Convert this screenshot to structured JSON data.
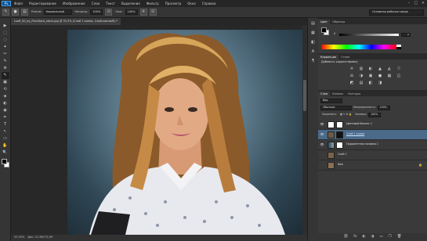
{
  "app": {
    "logo": "Ps"
  },
  "menu": [
    "Файл",
    "Редактирование",
    "Изображение",
    "Слои",
    "Текст",
    "Выделение",
    "Фильтр",
    "Просмотр",
    "Окно",
    "Справка"
  ],
  "window_buttons": [
    "–",
    "□",
    "×"
  ],
  "options": {
    "feather_label": "Режим:",
    "mode_value": "Нормальный",
    "opacity_label": "Непрозр.:",
    "opacity_value": "100%",
    "flow_label": "Наж.:",
    "flow_value": "100%",
    "workspace": "Основная рабочая среда"
  },
  "document_tab": "Lsoff_00_by_FlexStock_stock.jpg @ 33,3% (Слой 1 копия, Слой-маска/8) *",
  "status": {
    "zoom": "33,33%",
    "doc": "Док: 22,9М/73,2М"
  },
  "color_panel": {
    "tabs": [
      "Цвет",
      "Образцы"
    ],
    "sliders": [
      {
        "letter": "K",
        "value": "0",
        "level": 0.0
      }
    ],
    "fg_color": "#000000",
    "bg_color": "#ffffff"
  },
  "adjustments": {
    "tabs": [
      "Коррекция",
      "Стили"
    ],
    "title": "Добавить корректировку",
    "icons": [
      "☀",
      "▥",
      "◐",
      "▲",
      "◭",
      "▽",
      "⚖",
      "◑",
      "▣",
      "●",
      "▦",
      "◫",
      "◩",
      "▤",
      "◧",
      "◨"
    ]
  },
  "layers_panel": {
    "tabs": [
      "Слои",
      "Каналы",
      "Контуры"
    ],
    "kind_label": "Вид",
    "blend_mode": "Обычные",
    "opacity_label": "Непрозрачность:",
    "opacity_value": "100%",
    "lock_label": "Закрепить:",
    "fill_label": "Заливка:",
    "fill_value": "100%",
    "layers": [
      {
        "name": "Цветовой баланс 1",
        "thumb": "#ffffff",
        "visible": true,
        "selected": false,
        "link": false,
        "lock": ""
      },
      {
        "name": "Слой 1 копия",
        "thumb": "#6e5a44",
        "visible": true,
        "selected": true,
        "link": true,
        "lock": ""
      },
      {
        "name": "Градиентная заливка 1",
        "thumb": "#4f6b7d",
        "visible": true,
        "selected": false,
        "link": false,
        "lock": ""
      },
      {
        "name": "Слой 1",
        "thumb": "#7a6348",
        "visible": false,
        "selected": false,
        "link": false,
        "lock": ""
      },
      {
        "name": "Фон",
        "thumb": "#8a7153",
        "visible": false,
        "selected": false,
        "link": false,
        "lock": "🔒"
      }
    ],
    "footer_icons": [
      "⛓",
      "fx",
      "◐",
      "◑",
      "▭",
      "❐",
      "🗑"
    ]
  },
  "tools": [
    "▶",
    "⬚",
    "◌",
    "✦",
    "✂",
    "✎",
    "⊕",
    "✎",
    "▣",
    "⟲",
    "◈",
    "◐",
    "◉",
    "✒",
    "T",
    "↖",
    "▭",
    "✋",
    "🔍"
  ],
  "strip_icons": [
    "▤",
    "▦",
    "◧",
    "A",
    "¶"
  ]
}
